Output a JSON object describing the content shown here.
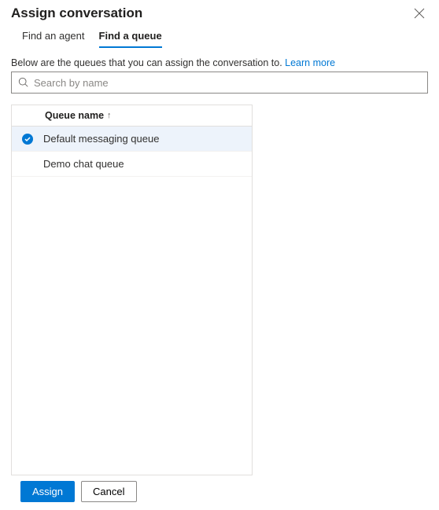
{
  "header": {
    "title": "Assign conversation"
  },
  "tabs": {
    "find_agent": "Find an agent",
    "find_queue": "Find a queue"
  },
  "instruction": {
    "text": "Below are the queues that you can assign the conversation to. ",
    "link": "Learn more"
  },
  "search": {
    "placeholder": "Search by name"
  },
  "table": {
    "column_header": "Queue name",
    "rows": [
      {
        "label": "Default messaging queue",
        "selected": true
      },
      {
        "label": "Demo chat queue",
        "selected": false
      }
    ]
  },
  "footer": {
    "assign": "Assign",
    "cancel": "Cancel"
  }
}
